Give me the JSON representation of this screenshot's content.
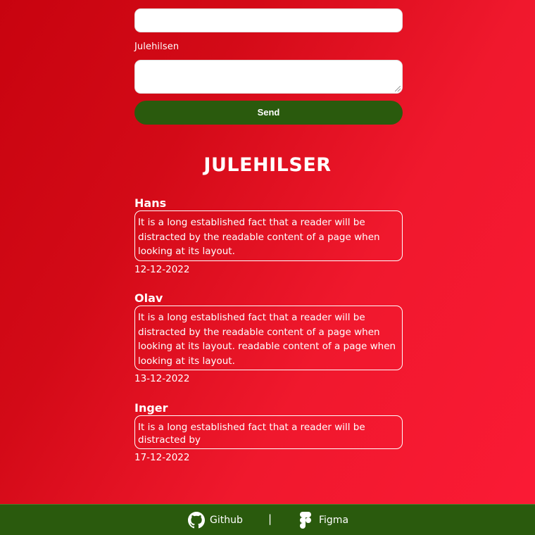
{
  "form": {
    "name_value": "",
    "message_label": "Julehilsen",
    "message_value": "",
    "send_label": "Send"
  },
  "greetings_title": "JULEHILSER",
  "greetings": [
    {
      "name": "Hans",
      "message": "It is a long established fact that a reader will be distracted by the readable content of a page when looking at its layout.",
      "date": "12-12-2022"
    },
    {
      "name": "Olav",
      "message": "It is a long established fact that a reader will be distracted by the readable content of a page when looking at its layout. readable content of a page when looking at its layout.",
      "date": "13-12-2022"
    },
    {
      "name": "Inger",
      "message": "It is a long established fact that a reader will be distracted by",
      "date": "17-12-2022"
    }
  ],
  "footer": {
    "github_label": "Github",
    "github_icon": "github-icon",
    "separator": "|",
    "figma_label": "Figma",
    "figma_icon": "figma-icon"
  },
  "colors": {
    "background_start": "#c8030f",
    "background_end": "#fb1a35",
    "accent_green": "#2a5a0d",
    "text": "#ffffff"
  }
}
